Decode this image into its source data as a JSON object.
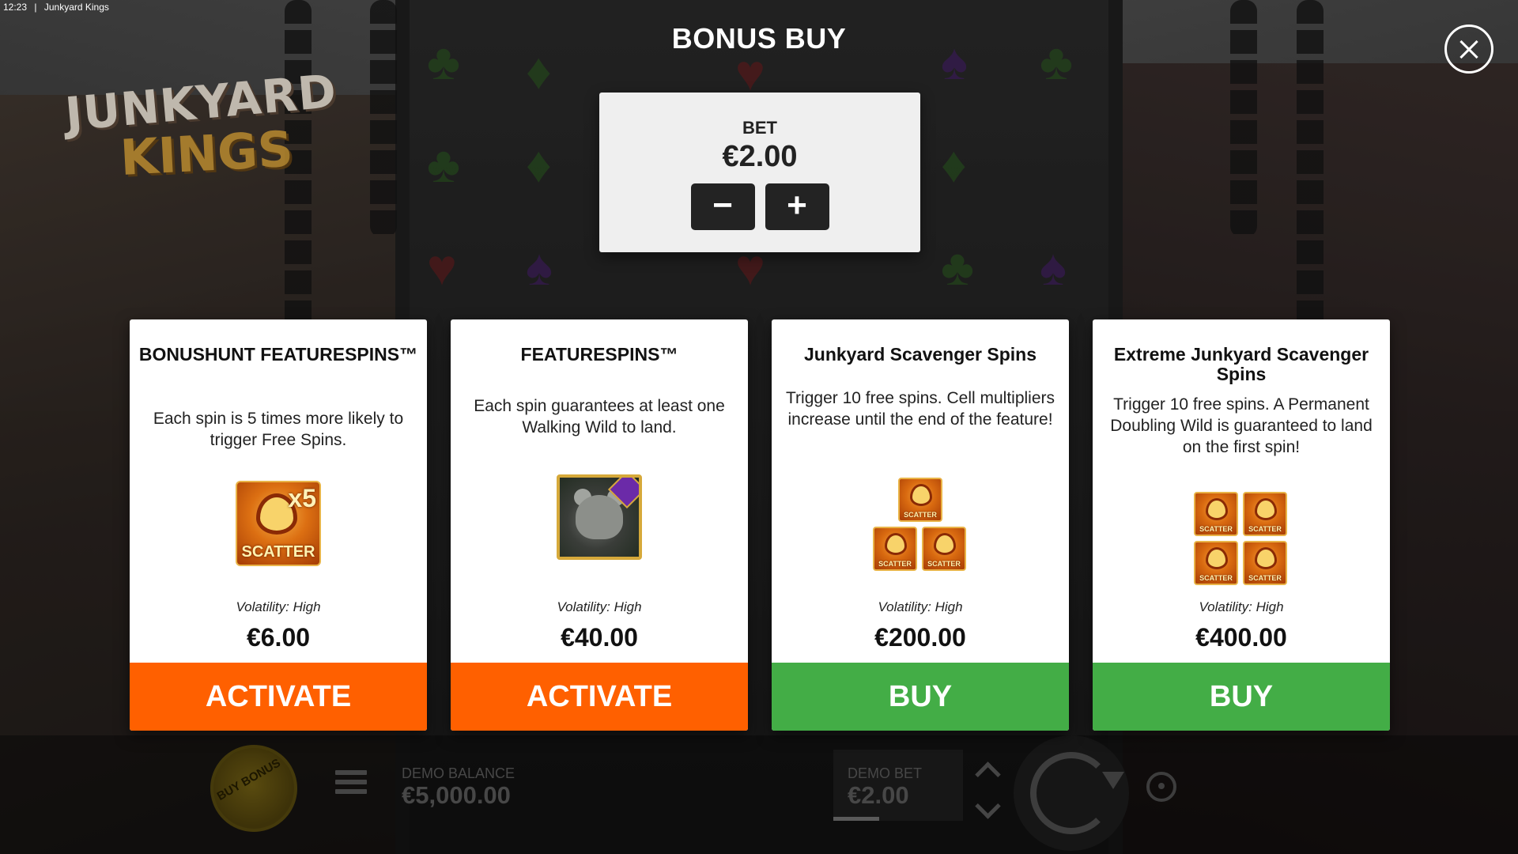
{
  "statusbar": {
    "time": "12:23",
    "separator": "|",
    "app_name": "Junkyard Kings"
  },
  "logo": {
    "line1": "JUNKYARD",
    "line2": "KINGS"
  },
  "modal": {
    "title": "BONUS BUY",
    "bet": {
      "label": "BET",
      "value": "€2.00",
      "decrease_label": "−",
      "increase_label": "+"
    }
  },
  "cards": [
    {
      "title": "BONUSHUNT FEATURESPINS™",
      "description": "Each spin is 5 times more likely to trigger Free Spins.",
      "symbol": "scatter-x5-icon",
      "symbol_text": "SCATTER",
      "symbol_multiplier": "x5",
      "volatility": "Volatility: High",
      "price": "€6.00",
      "action": "ACTIVATE",
      "action_color": "#ff6000"
    },
    {
      "title": "FEATURESPINS™",
      "description": "Each spin guarantees at least one Walking Wild to land.",
      "symbol": "walking-wild-icon",
      "volatility": "Volatility: High",
      "price": "€40.00",
      "action": "ACTIVATE",
      "action_color": "#ff6000"
    },
    {
      "title": "Junkyard Scavenger Spins",
      "description": "Trigger 10 free spins. Cell multipliers increase until the end of the feature!",
      "symbol": "scatter-x3-icon",
      "symbol_text": "SCATTER",
      "volatility": "Volatility: High",
      "price": "€200.00",
      "action": "BUY",
      "action_color": "#43ad46"
    },
    {
      "title": "Extreme Junkyard Scavenger Spins",
      "description": "Trigger 10 free spins. A Permanent Doubling Wild is guaranteed to land on the first spin!",
      "symbol": "scatter-x4-icon",
      "symbol_text": "SCATTER",
      "volatility": "Volatility: High",
      "price": "€400.00",
      "action": "BUY",
      "action_color": "#43ad46"
    }
  ],
  "bottom_bar": {
    "buy_bonus_label": "BUY BONUS",
    "balance_label": "DEMO BALANCE",
    "balance_value": "€5,000.00",
    "bet_label": "DEMO BET",
    "bet_value": "€2.00"
  }
}
